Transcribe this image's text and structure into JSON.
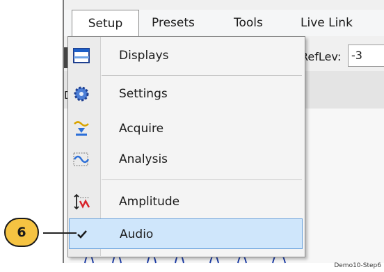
{
  "menubar": {
    "items": [
      {
        "label": "Setup"
      },
      {
        "label": "Presets"
      },
      {
        "label": "Tools"
      },
      {
        "label": "Live Link"
      }
    ]
  },
  "toolbar": {
    "reflev_label": "RefLev:",
    "reflev_value": "-3"
  },
  "strip2": {
    "partial_text": "De"
  },
  "setup_menu": {
    "items": [
      {
        "label": "Displays",
        "icon": "displays-icon"
      },
      {
        "label": "Settings",
        "icon": "gear-icon"
      },
      {
        "label": "Acquire",
        "icon": "acquire-icon"
      },
      {
        "label": "Analysis",
        "icon": "analysis-icon"
      },
      {
        "label": "Amplitude",
        "icon": "amplitude-icon"
      },
      {
        "label": "Audio",
        "icon": "checkmark-icon",
        "checked": true,
        "highlighted": true
      }
    ]
  },
  "callout": {
    "step_number": "6"
  },
  "footer": {
    "tag": "Demo10-Step6"
  },
  "colors": {
    "highlight_bg": "#cfe6fb",
    "highlight_border": "#6aa2dc",
    "callout_fill": "#f5c342"
  }
}
